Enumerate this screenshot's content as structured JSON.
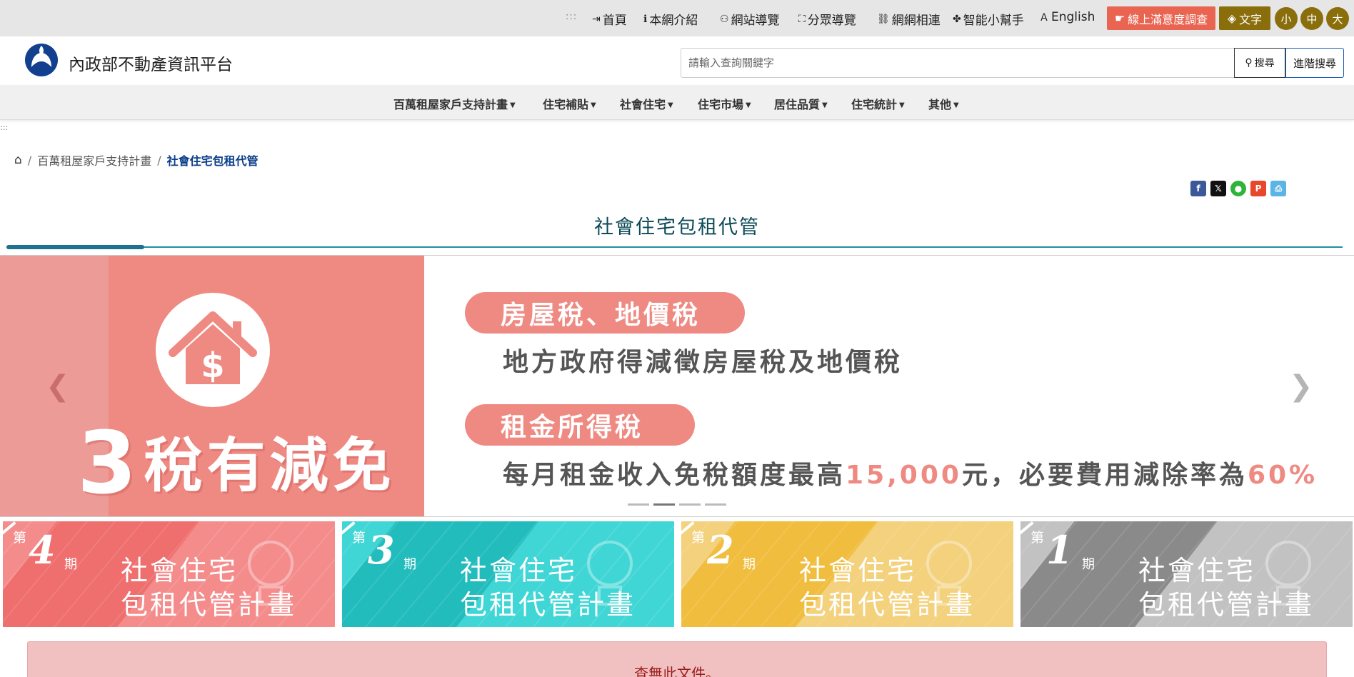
{
  "topbar": {
    "accesskey": ":::",
    "links": [
      {
        "icon": "sign-in-icon",
        "glyph": "⇥",
        "label": "首頁"
      },
      {
        "icon": "info-icon",
        "glyph": "ℹ",
        "label": "本網介紹"
      },
      {
        "icon": "sitemap-icon",
        "glyph": "⚇",
        "label": "網站導覽"
      },
      {
        "icon": "audience-icon",
        "glyph": "⛶",
        "label": "分眾導覽"
      },
      {
        "icon": "link-icon",
        "glyph": "⛓",
        "label": "網網相連"
      },
      {
        "icon": "helper-icon",
        "glyph": "✤",
        "label": "智能小幫手"
      },
      {
        "icon": "language-icon",
        "glyph": "Ａ",
        "label": "English"
      }
    ],
    "survey_label": "線上滿意度調查",
    "text_label": "文字",
    "font_sizes": [
      "小",
      "中",
      "大"
    ],
    "colors": {
      "survey": "#e96552",
      "gold": "#8b6e0c"
    }
  },
  "header": {
    "site_title": "內政部不動產資訊平台",
    "search_placeholder": "請輸入查詢關鍵字",
    "search_label": "搜尋",
    "advanced_label": "進階搜尋"
  },
  "nav": {
    "items": [
      "百萬租屋家戶支持計畫",
      "住宅補貼",
      "社會住宅",
      "住宅市場",
      "居住品質",
      "住宅統計",
      "其他"
    ]
  },
  "accesskey2": ":::",
  "breadcrumb": {
    "items": [
      "百萬租屋家戶支持計畫",
      "社會住宅包租代管"
    ]
  },
  "share": [
    {
      "icon": "facebook-icon",
      "glyph": "f",
      "color": "#3b5998"
    },
    {
      "icon": "x-icon",
      "glyph": "𝕏",
      "color": "#111111"
    },
    {
      "icon": "line-icon",
      "glyph": "●",
      "color": "#2fb33a"
    },
    {
      "icon": "plurk-icon",
      "glyph": "P",
      "color": "#e8472c"
    },
    {
      "icon": "print-icon",
      "glyph": "⎙",
      "color": "#5ab4e5"
    }
  ],
  "page_title": "社會住宅包租代管",
  "carousel": {
    "headline_digit": "3",
    "headline_text": "稅有減免",
    "pill1": "房屋稅、地價稅",
    "text1": "地方政府得減徵房屋稅及地價稅",
    "pill2": "租金所得稅",
    "text2_a": "每月租金收入免稅額度最高",
    "text2_b": "15,000",
    "text2_c": "元，必要費用減除率為",
    "text2_d": "60%",
    "slide_count": 4,
    "active_index": 1,
    "colors": {
      "salmon": "#ef8a83"
    }
  },
  "cards": [
    {
      "di": "第",
      "num": "4",
      "qi": "期",
      "line1": "社會住宅",
      "line2": "包租代管計畫",
      "color": "#f58c8c",
      "dark": "#ef6e6e"
    },
    {
      "di": "第",
      "num": "3",
      "qi": "期",
      "line1": "社會住宅",
      "line2": "包租代管計畫",
      "color": "#40d6d6",
      "dark": "#22bcbc"
    },
    {
      "di": "第",
      "num": "2",
      "qi": "期",
      "line1": "社會住宅",
      "line2": "包租代管計畫",
      "color": "#f3d17d",
      "dark": "#f0bd3e"
    },
    {
      "di": "第",
      "num": "1",
      "qi": "期",
      "line1": "社會住宅",
      "line2": "包租代管計畫",
      "color": "#c2c2c2",
      "dark": "#8a8a8a"
    }
  ],
  "alert": {
    "message": "查無此文件。"
  }
}
